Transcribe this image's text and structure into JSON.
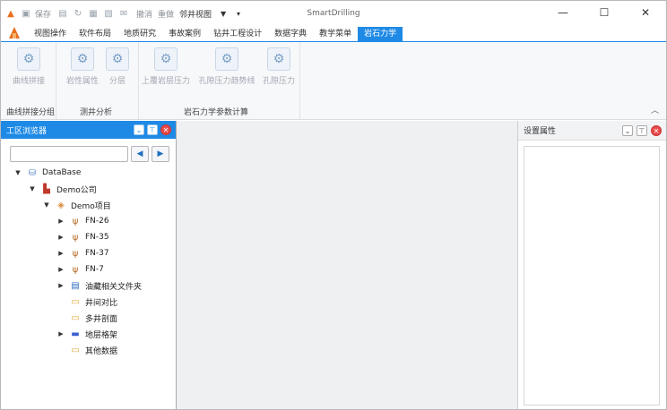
{
  "app": {
    "title": "SmartDrilling"
  },
  "quick_access": {
    "save_label": "保存",
    "dropdown_value": "邻井视图",
    "extra_labels": [
      "撤消",
      "重做"
    ]
  },
  "window_controls": {
    "minimize": "—",
    "maximize": "☐",
    "close": "✕"
  },
  "tabs": [
    {
      "label": "视图操作",
      "active": false
    },
    {
      "label": "软件布局",
      "active": false
    },
    {
      "label": "地质研究",
      "active": false
    },
    {
      "label": "事故案例",
      "active": false
    },
    {
      "label": "钻井工程设计",
      "active": false
    },
    {
      "label": "数据字典",
      "active": false
    },
    {
      "label": "教学菜单",
      "active": false
    },
    {
      "label": "岩石力学",
      "active": true
    }
  ],
  "ribbon": {
    "groups": [
      {
        "label": "曲线拼接分组",
        "buttons": [
          "曲线拼接"
        ]
      },
      {
        "label": "测井分析",
        "buttons": [
          "岩性属性",
          "分层"
        ]
      },
      {
        "label": "岩石力学参数计算",
        "buttons": [
          "上覆岩层压力",
          "孔隙压力趋势线",
          "孔隙压力"
        ]
      }
    ]
  },
  "left_panel": {
    "title": "工区浏览器",
    "search_placeholder": "",
    "nav_prev": "◀",
    "nav_next": "▶"
  },
  "tree": [
    {
      "label": "DataBase",
      "level": 0,
      "toggle": "▼",
      "icon": "database-icon"
    },
    {
      "label": "Demo公司",
      "level": 1,
      "toggle": "▼",
      "icon": "company-icon"
    },
    {
      "label": "Demo项目",
      "level": 2,
      "toggle": "▼",
      "icon": "project-icon"
    },
    {
      "label": "FN-26",
      "level": 3,
      "toggle": "▶",
      "icon": "well-icon"
    },
    {
      "label": "FN-35",
      "level": 3,
      "toggle": "▶",
      "icon": "well-icon"
    },
    {
      "label": "FN-37",
      "level": 3,
      "toggle": "▶",
      "icon": "well-icon"
    },
    {
      "label": "FN-7",
      "level": 3,
      "toggle": "▶",
      "icon": "well-icon"
    },
    {
      "label": "油藏相关文件夹",
      "level": 3,
      "toggle": "▶",
      "icon": "folder-doc-icon"
    },
    {
      "label": "井间对比",
      "level": 3,
      "toggle": "",
      "icon": "folder-icon"
    },
    {
      "label": "多井剖面",
      "level": 3,
      "toggle": "",
      "icon": "folder-icon"
    },
    {
      "label": "地层格架",
      "level": 3,
      "toggle": "▶",
      "icon": "folder-blue-icon"
    },
    {
      "label": "其他数据",
      "level": 3,
      "toggle": "",
      "icon": "folder-icon"
    }
  ],
  "right_panel": {
    "title": "设置属性"
  },
  "colors": {
    "accent": "#1e8ae6",
    "close": "#e84a4a",
    "center_bg": "#eff0f1"
  }
}
